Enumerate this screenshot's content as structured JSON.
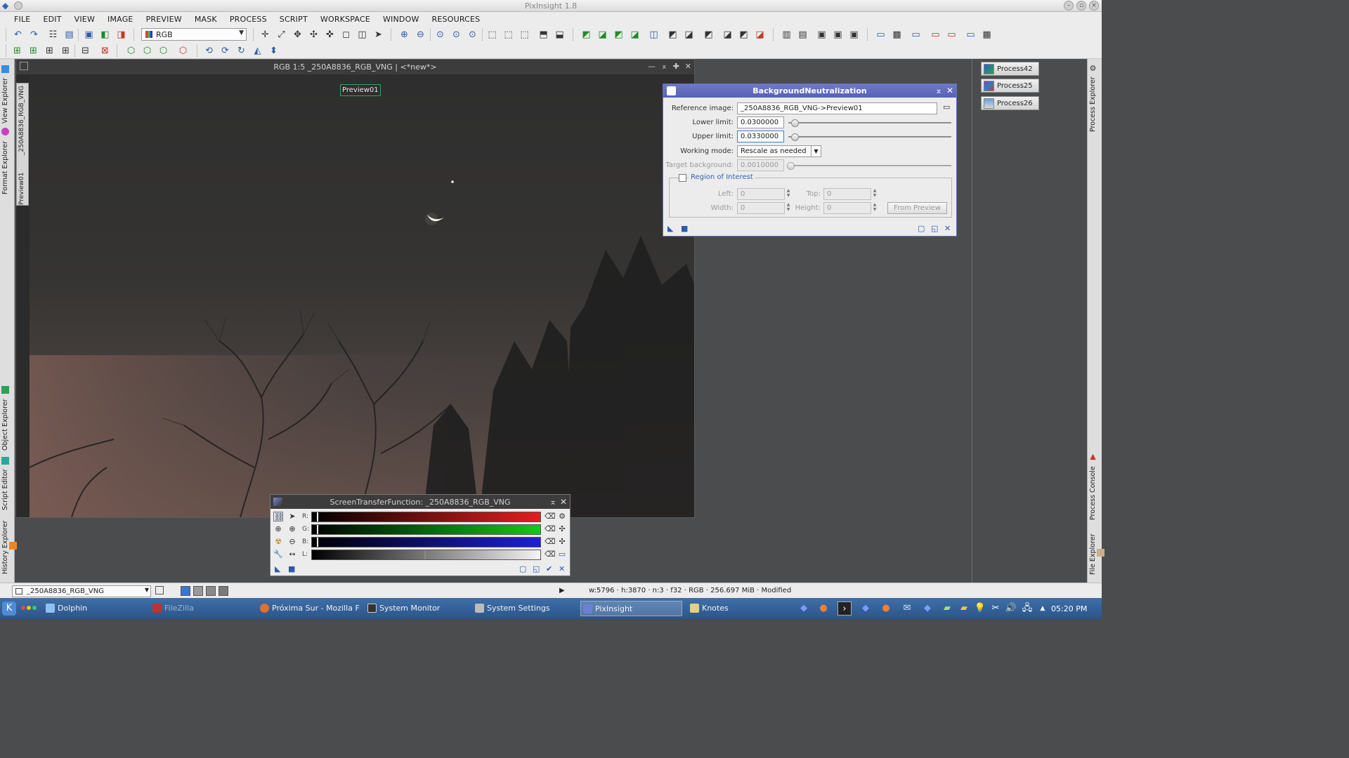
{
  "app": {
    "title": "PixInsight 1.8"
  },
  "menu": [
    "FILE",
    "EDIT",
    "VIEW",
    "IMAGE",
    "PREVIEW",
    "MASK",
    "PROCESS",
    "SCRIPT",
    "WORKSPACE",
    "WINDOW",
    "RESOURCES"
  ],
  "toolbar": {
    "rgb_mode": "RGB"
  },
  "left_dock_tabs": [
    "View Explorer",
    "Format Explorer",
    "Object Explorer",
    "Script Editor",
    "History Explorer"
  ],
  "right_dock_tabs": [
    "Process Explorer",
    "Process Console",
    "File Explorer"
  ],
  "image_window": {
    "title": "RGB 1:5 _250A8836_RGB_VNG | <*new*>",
    "view_tabs": [
      "_250A8836_RGB_VNG",
      "Preview01"
    ],
    "preview_label": "Preview01"
  },
  "bgn": {
    "title": "BackgroundNeutralization",
    "reference_label": "Reference image:",
    "reference_value": "_250A8836_RGB_VNG->Preview01",
    "lower_label": "Lower limit:",
    "lower_value": "0.0300000",
    "upper_label": "Upper limit:",
    "upper_value": "0.0330000",
    "mode_label": "Working mode:",
    "mode_value": "Rescale as needed",
    "target_label": "Target background:",
    "target_value": "0.0010000",
    "roi_label": "Region of Interest",
    "roi_checked": false,
    "left_label": "Left:",
    "left_value": "0",
    "top_label": "Top:",
    "top_value": "0",
    "width_label": "Width:",
    "width_value": "0",
    "height_label": "Height:",
    "height_value": "0",
    "from_preview_label": "From Preview"
  },
  "process_icons": [
    "Process42",
    "Process25",
    "Process26"
  ],
  "stf": {
    "title": "ScreenTransferFunction: _250A8836_RGB_VNG",
    "channels": [
      "R:",
      "G:",
      "B:",
      "L:"
    ]
  },
  "status": {
    "view_selector": "_250A8836_RGB_VNG",
    "info": "w:5796 · h:3870 · n:3 · f32 · RGB · 256.697 MiB · Modified"
  },
  "taskbar": {
    "tasks": [
      "Dolphin",
      "FileZilla",
      "Próxima Sur - Mozilla Firef...",
      "System Monitor",
      "System Settings",
      "PixInsight",
      "Knotes"
    ],
    "clock": "05:20 PM"
  }
}
